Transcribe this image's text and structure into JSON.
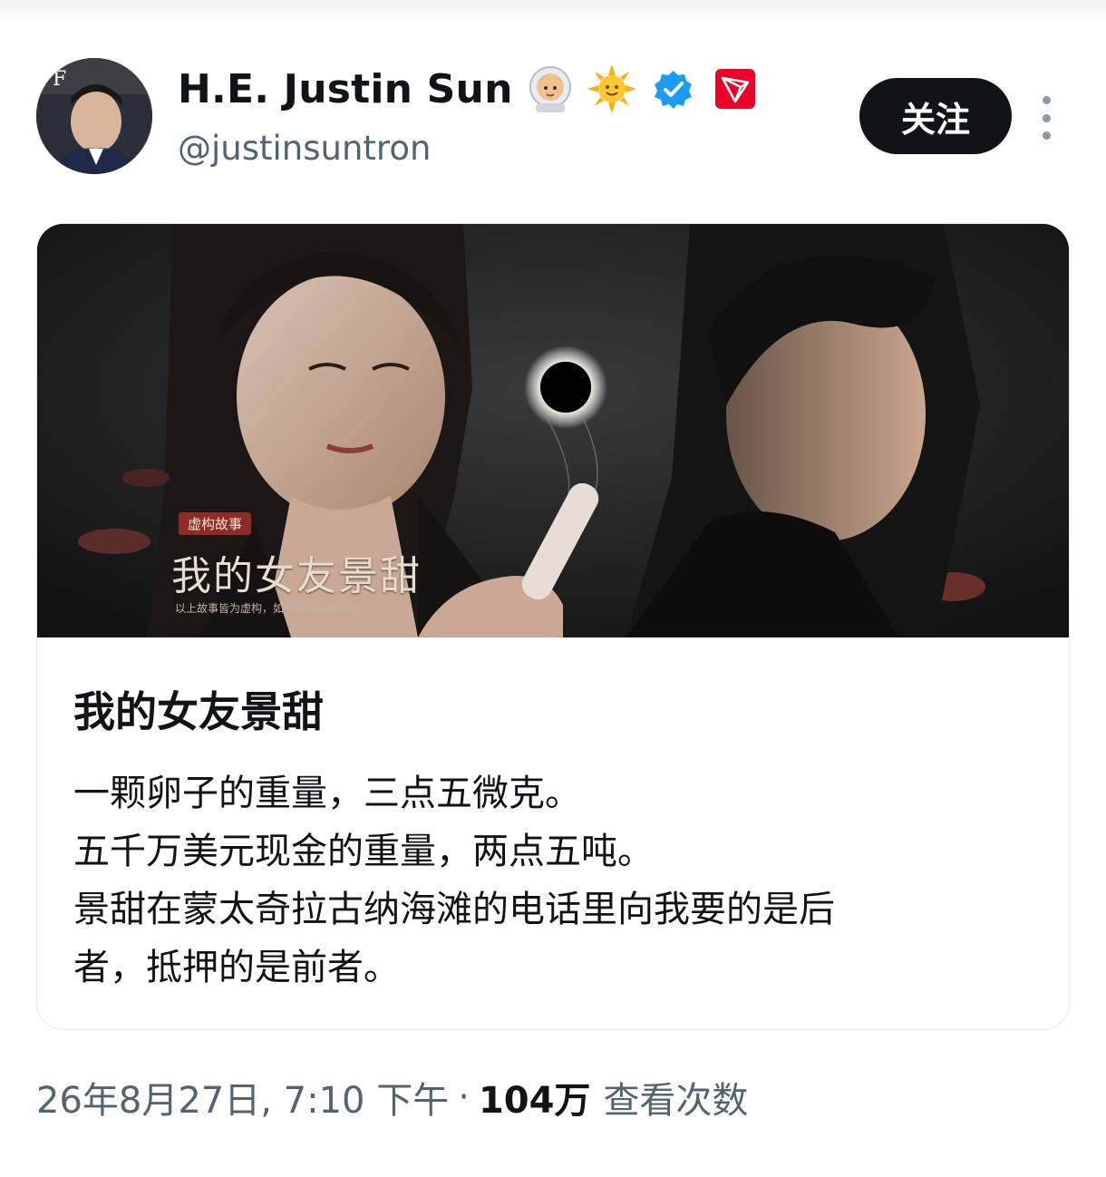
{
  "author": {
    "display_name": "H.E. Justin Sun",
    "handle": "@justinsuntron",
    "badges": [
      "astronaut-emoji",
      "sun-emoji",
      "verified-badge-icon",
      "tron-logo-icon"
    ],
    "avatar_label": "F"
  },
  "actions": {
    "follow_label": "关注",
    "more_icon": "more-vertical-icon"
  },
  "card": {
    "image": {
      "tag": "虚构故事",
      "title": "我的女友景甜",
      "disclaimer": "以上故事皆为虚构，如有雷同纯属巧合"
    },
    "title": "我的女友景甜",
    "body_lines": [
      "一颗卵子的重量，三点五微克。",
      "五千万美元现金的重量，两点五吨。",
      "景甜在蒙太奇拉古纳海滩的电话里向我要的是后",
      "者，抵押的是前者。"
    ]
  },
  "meta": {
    "timestamp": "26年8月27日, 7:10 下午",
    "separator": "·",
    "views_count": "104万",
    "views_label": "查看次数"
  },
  "colors": {
    "text_primary": "#0f1419",
    "text_secondary": "#536471",
    "verified_blue": "#1d9bf0",
    "tron_red": "#eb0029",
    "button_bg": "#0f1419"
  }
}
